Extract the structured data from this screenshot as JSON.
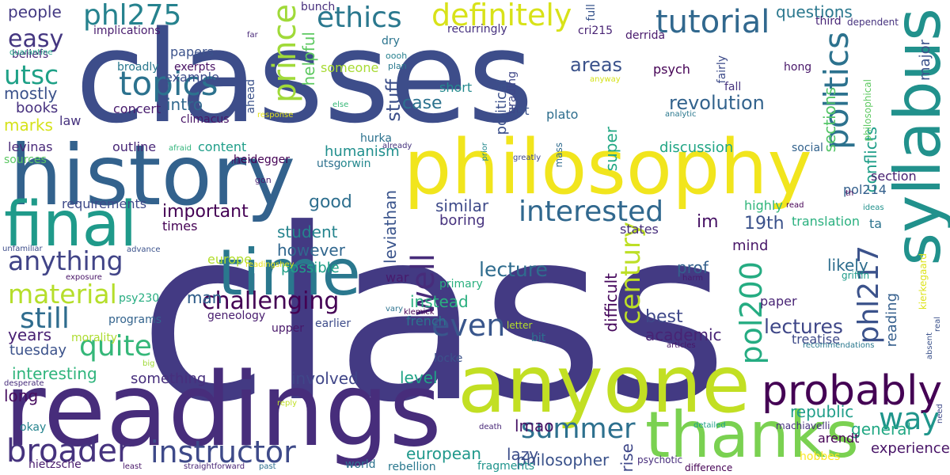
{
  "words": [
    {
      "text": "class",
      "color": "#433a83",
      "vertical": false
    },
    {
      "text": "classes",
      "color": "#3d4d8a",
      "vertical": false
    },
    {
      "text": "readings",
      "color": "#472d7b",
      "vertical": false
    },
    {
      "text": "history",
      "color": "#33628d",
      "vertical": false
    },
    {
      "text": "philosophy",
      "color": "#f1e51d",
      "vertical": false
    },
    {
      "text": "anyone",
      "color": "#c2df23",
      "vertical": false
    },
    {
      "text": "time",
      "color": "#2a788e",
      "vertical": false
    },
    {
      "text": "final",
      "color": "#1f9a8a",
      "vertical": false
    },
    {
      "text": "thanks",
      "color": "#7ad151",
      "vertical": false
    },
    {
      "text": "syllabus",
      "color": "#21918c",
      "vertical": true
    },
    {
      "text": "probably",
      "color": "#440154",
      "vertical": false
    },
    {
      "text": "broader",
      "color": "#46337e",
      "vertical": false
    },
    {
      "text": "instructor",
      "color": "#3e4a89",
      "vertical": false
    },
    {
      "text": "tutorial",
      "color": "#31688e",
      "vertical": false
    },
    {
      "text": "definitely",
      "color": "#d8e219",
      "vertical": false
    },
    {
      "text": "topics",
      "color": "#2c728e",
      "vertical": false
    },
    {
      "text": "phl275",
      "color": "#26828e",
      "vertical": false
    },
    {
      "text": "easy",
      "color": "#453781",
      "vertical": false
    },
    {
      "text": "utsc",
      "color": "#1fa187",
      "vertical": false
    },
    {
      "text": "ethics",
      "color": "#2a788e",
      "vertical": false
    },
    {
      "text": "anything",
      "color": "#414487",
      "vertical": false
    },
    {
      "text": "material",
      "color": "#b5de2b",
      "vertical": false
    },
    {
      "text": "still",
      "color": "#2f6c8e",
      "vertical": false
    },
    {
      "text": "quite",
      "color": "#35b779",
      "vertical": false
    },
    {
      "text": "interested",
      "color": "#31688e",
      "vertical": false
    },
    {
      "text": "challenging",
      "color": "#440154",
      "vertical": false
    },
    {
      "text": "even",
      "color": "#39568c",
      "vertical": false
    },
    {
      "text": "politics",
      "color": "#2c728e",
      "vertical": true
    },
    {
      "text": "prince",
      "color": "#a0da39",
      "vertical": true
    },
    {
      "text": "century",
      "color": "#bddf26",
      "vertical": true
    },
    {
      "text": "pol200",
      "color": "#25ac82",
      "vertical": true
    },
    {
      "text": "phl217",
      "color": "#3b528b",
      "vertical": true
    },
    {
      "text": "well",
      "color": "#472c7a",
      "vertical": true
    },
    {
      "text": "way",
      "color": "#1f958b",
      "vertical": false
    },
    {
      "text": "summer",
      "color": "#2d708e",
      "vertical": false
    },
    {
      "text": "revolution",
      "color": "#33638d",
      "vertical": false
    },
    {
      "text": "lecture",
      "color": "#2f6c8e",
      "vertical": false
    },
    {
      "text": "lectures",
      "color": "#3f4788",
      "vertical": false
    },
    {
      "text": "questions",
      "color": "#2a788e",
      "vertical": false
    },
    {
      "text": "people",
      "color": "#443a83",
      "vertical": false
    },
    {
      "text": "mostly",
      "color": "#3b528b",
      "vertical": false
    },
    {
      "text": "marks",
      "color": "#d5e21a",
      "vertical": false
    },
    {
      "text": "books",
      "color": "#46307e",
      "vertical": false
    },
    {
      "text": "intro",
      "color": "#31688e",
      "vertical": false
    },
    {
      "text": "case",
      "color": "#2c728e",
      "vertical": false
    },
    {
      "text": "stuff",
      "color": "#3c4f8a",
      "vertical": true
    },
    {
      "text": "helpful",
      "color": "#5ec962",
      "vertical": true
    },
    {
      "text": "areas",
      "color": "#3b528b",
      "vertical": false
    },
    {
      "text": "super",
      "color": "#22a884",
      "vertical": true
    },
    {
      "text": "political",
      "color": "#3c508b",
      "vertical": true
    },
    {
      "text": "humanism",
      "color": "#218f8d",
      "vertical": false
    },
    {
      "text": "sections",
      "color": "#54c568",
      "vertical": true
    },
    {
      "text": "conflicts",
      "color": "#1f9e89",
      "vertical": true
    },
    {
      "text": "important",
      "color": "#440154",
      "vertical": false
    },
    {
      "text": "good",
      "color": "#2e6f8e",
      "vertical": false
    },
    {
      "text": "similar",
      "color": "#3e4a89",
      "vertical": false
    },
    {
      "text": "im",
      "color": "#471365",
      "vertical": false
    },
    {
      "text": "19th",
      "color": "#3b528b",
      "vertical": false
    },
    {
      "text": "student",
      "color": "#25848e",
      "vertical": false
    },
    {
      "text": "however",
      "color": "#31678e",
      "vertical": false
    },
    {
      "text": "possible",
      "color": "#1fa088",
      "vertical": false
    },
    {
      "text": "instead",
      "color": "#29af7f",
      "vertical": false
    },
    {
      "text": "leviathan",
      "color": "#3a548c",
      "vertical": true
    },
    {
      "text": "boring",
      "color": "#46327e",
      "vertical": false
    },
    {
      "text": "prof",
      "color": "#34608d",
      "vertical": false
    },
    {
      "text": "likely",
      "color": "#2e6e8e",
      "vertical": false
    },
    {
      "text": "mind",
      "color": "#481769",
      "vertical": false
    },
    {
      "text": "best",
      "color": "#3f4889",
      "vertical": false
    },
    {
      "text": "academic",
      "color": "#482374",
      "vertical": false
    },
    {
      "text": "reading",
      "color": "#355f8d",
      "vertical": true
    },
    {
      "text": "difficult",
      "color": "#46085c",
      "vertical": true
    },
    {
      "text": "interesting",
      "color": "#2fb47c",
      "vertical": false
    },
    {
      "text": "involved",
      "color": "#404688",
      "vertical": false
    },
    {
      "text": "years",
      "color": "#482173",
      "vertical": false
    },
    {
      "text": "tuesday",
      "color": "#3b528b",
      "vertical": false
    },
    {
      "text": "long",
      "color": "#470d60",
      "vertical": false
    },
    {
      "text": "something",
      "color": "#472f7d",
      "vertical": false
    },
    {
      "text": "level",
      "color": "#20a386",
      "vertical": false
    },
    {
      "text": "lmao",
      "color": "#471365",
      "vertical": false
    },
    {
      "text": "republic",
      "color": "#1f9e89",
      "vertical": false
    },
    {
      "text": "general",
      "color": "#22a884",
      "vertical": false
    },
    {
      "text": "experience",
      "color": "#481467",
      "vertical": false
    },
    {
      "text": "european",
      "color": "#1f988b",
      "vertical": false
    },
    {
      "text": "lazy",
      "color": "#3d4e8a",
      "vertical": false
    },
    {
      "text": "rise",
      "color": "#3f4889",
      "vertical": true
    },
    {
      "text": "philosopher",
      "color": "#3b528b",
      "vertical": false
    },
    {
      "text": "man",
      "color": "#34618d",
      "vertical": false
    },
    {
      "text": "paper",
      "color": "#482475",
      "vertical": false
    },
    {
      "text": "man",
      "color": "#34618d",
      "vertical": false
    },
    {
      "text": "content",
      "color": "#1f9e89",
      "vertical": false
    },
    {
      "text": "outline",
      "color": "#482677",
      "vertical": false
    },
    {
      "text": "discussion",
      "color": "#21a685",
      "vertical": false
    },
    {
      "text": "example",
      "color": "#3d4d8a",
      "vertical": false
    },
    {
      "text": "concert",
      "color": "#481c6e",
      "vertical": false
    },
    {
      "text": "law",
      "color": "#46327e",
      "vertical": false
    },
    {
      "text": "levinas",
      "color": "#482878",
      "vertical": false
    },
    {
      "text": "requirements",
      "color": "#3e4989",
      "vertical": false
    },
    {
      "text": "times",
      "color": "#440154",
      "vertical": false
    },
    {
      "text": "europe",
      "color": "#b2dd2d",
      "vertical": false
    },
    {
      "text": "war",
      "color": "#481a6c",
      "vertical": false
    },
    {
      "text": "french",
      "color": "#2c738e",
      "vertical": false
    },
    {
      "text": "states",
      "color": "#472e7c",
      "vertical": false
    },
    {
      "text": "highly",
      "color": "#31b57b",
      "vertical": false
    },
    {
      "text": "section",
      "color": "#482071",
      "vertical": false
    },
    {
      "text": "pol214",
      "color": "#34608d",
      "vertical": false
    },
    {
      "text": "translation",
      "color": "#2ab07f",
      "vertical": false
    },
    {
      "text": "ta",
      "color": "#2c738e",
      "vertical": false
    },
    {
      "text": "treatise",
      "color": "#3e4a89",
      "vertical": false
    },
    {
      "text": "papers",
      "color": "#3b528b",
      "vertical": false
    },
    {
      "text": "beliefs",
      "color": "#482878",
      "vertical": false
    },
    {
      "text": "implications",
      "color": "#481b6d",
      "vertical": false
    },
    {
      "text": "broadly",
      "color": "#2a788e",
      "vertical": false
    },
    {
      "text": "exerpts",
      "color": "#471063",
      "vertical": false
    },
    {
      "text": "climacus",
      "color": "#481467",
      "vertical": false
    },
    {
      "text": "sources",
      "color": "#5cc863",
      "vertical": false
    },
    {
      "text": "someone",
      "color": "#a8db34",
      "vertical": false
    },
    {
      "text": "heidegger",
      "color": "#440154",
      "vertical": false
    },
    {
      "text": "list",
      "color": "#3b528b",
      "vertical": false
    },
    {
      "text": "plato",
      "color": "#2e6e8e",
      "vertical": false
    },
    {
      "text": "grading",
      "color": "#3f4788",
      "vertical": true
    },
    {
      "text": "short",
      "color": "#23898e",
      "vertical": false
    },
    {
      "text": "psych",
      "color": "#440154",
      "vertical": false
    },
    {
      "text": "hong",
      "color": "#481769",
      "vertical": false
    },
    {
      "text": "fall",
      "color": "#46337e",
      "vertical": false
    },
    {
      "text": "derrida",
      "color": "#481a6c",
      "vertical": false
    },
    {
      "text": "cri215",
      "color": "#482374",
      "vertical": false
    },
    {
      "text": "recurringly",
      "color": "#46317e",
      "vertical": false
    },
    {
      "text": "bunch",
      "color": "#472f7d",
      "vertical": false
    },
    {
      "text": "third",
      "color": "#482677",
      "vertical": false
    },
    {
      "text": "major",
      "color": "#3b528b",
      "vertical": true
    },
    {
      "text": "full",
      "color": "#39568c",
      "vertical": true
    },
    {
      "text": "dependent",
      "color": "#46327e",
      "vertical": false
    },
    {
      "text": "dry",
      "color": "#2b748e",
      "vertical": false
    },
    {
      "text": "oooh",
      "color": "#27808e",
      "vertical": false
    },
    {
      "text": "plan",
      "color": "#2a788e",
      "vertical": false
    },
    {
      "text": "ahead",
      "color": "#3b528b",
      "vertical": true
    },
    {
      "text": "fairly",
      "color": "#3e4c8a",
      "vertical": true
    },
    {
      "text": "philosophical",
      "color": "#5ec962",
      "vertical": true
    },
    {
      "text": "hurka",
      "color": "#2c728e",
      "vertical": false
    },
    {
      "text": "utsg",
      "color": "#2d718e",
      "vertical": false
    },
    {
      "text": "orwin",
      "color": "#23888e",
      "vertical": false
    },
    {
      "text": "social",
      "color": "#33638d",
      "vertical": false
    },
    {
      "text": "gon",
      "color": "#482071",
      "vertical": false
    },
    {
      "text": "quarantine",
      "color": "#20a386",
      "vertical": false
    },
    {
      "text": "far",
      "color": "#482878",
      "vertical": false
    },
    {
      "text": "response",
      "color": "#e5e419",
      "vertical": false
    },
    {
      "text": "else",
      "color": "#37b878",
      "vertical": false
    },
    {
      "text": "anyway",
      "color": "#d5e21a",
      "vertical": false
    },
    {
      "text": "analytic",
      "color": "#2a788e",
      "vertical": false
    },
    {
      "text": "afraid",
      "color": "#31b57b",
      "vertical": false
    },
    {
      "text": "already",
      "color": "#46337e",
      "vertical": false
    },
    {
      "text": "greatly",
      "color": "#3f4889",
      "vertical": false
    },
    {
      "text": "prior",
      "color": "#23898e",
      "vertical": true
    },
    {
      "text": "mass",
      "color": "#2f6b8e",
      "vertical": true
    },
    {
      "text": "th",
      "color": "#440154",
      "vertical": false
    },
    {
      "text": "na",
      "color": "#481c6e",
      "vertical": false
    },
    {
      "text": "read",
      "color": "#440154",
      "vertical": false
    },
    {
      "text": "ideas",
      "color": "#21918c",
      "vertical": false
    },
    {
      "text": "kierkegaard",
      "color": "#dde318",
      "vertical": true
    },
    {
      "text": "griffin",
      "color": "#1e9b8a",
      "vertical": false
    },
    {
      "text": "harm",
      "color": "#481b6d",
      "vertical": false
    },
    {
      "text": "real",
      "color": "#3b528b",
      "vertical": true
    },
    {
      "text": "unfamiliar",
      "color": "#3d4d8a",
      "vertical": false
    },
    {
      "text": "advance",
      "color": "#3b528b",
      "vertical": false
    },
    {
      "text": "readingshey",
      "color": "#e7e419",
      "vertical": false
    },
    {
      "text": "exposure",
      "color": "#481467",
      "vertical": false
    },
    {
      "text": "primary",
      "color": "#2ab07f",
      "vertical": false
    },
    {
      "text": "psy230",
      "color": "#27ad81",
      "vertical": false
    },
    {
      "text": "programs",
      "color": "#33638d",
      "vertical": false
    },
    {
      "text": "morality",
      "color": "#addc30",
      "vertical": false
    },
    {
      "text": "geneology",
      "color": "#481c6e",
      "vertical": false
    },
    {
      "text": "upper",
      "color": "#481769",
      "vertical": false
    },
    {
      "text": "earlier",
      "color": "#3e4c8a",
      "vertical": false
    },
    {
      "text": "vary",
      "color": "#2c728e",
      "vertical": false
    },
    {
      "text": "klemick",
      "color": "#440154",
      "vertical": false
    },
    {
      "text": "letter",
      "color": "#b5de2b",
      "vertical": false
    },
    {
      "text": "bit",
      "color": "#2d708e",
      "vertical": false
    },
    {
      "text": "locke",
      "color": "#3b528b",
      "vertical": false
    },
    {
      "text": "articles",
      "color": "#481769",
      "vertical": false
    },
    {
      "text": "absent",
      "color": "#3b528b",
      "vertical": true
    },
    {
      "text": "recommendations",
      "color": "#2a788e",
      "vertical": false
    },
    {
      "text": "big",
      "color": "#a0da39",
      "vertical": false
    },
    {
      "text": "desperate",
      "color": "#472d7b",
      "vertical": false
    },
    {
      "text": "reply",
      "color": "#c0df25",
      "vertical": false
    },
    {
      "text": "okay",
      "color": "#25848e",
      "vertical": false
    },
    {
      "text": "need",
      "color": "#3e4989",
      "vertical": true
    },
    {
      "text": "machiavelli",
      "color": "#46327e",
      "vertical": false
    },
    {
      "text": "detailed",
      "color": "#1fa187",
      "vertical": false
    },
    {
      "text": "death",
      "color": "#482878",
      "vertical": false
    },
    {
      "text": "arendt",
      "color": "#440154",
      "vertical": false
    },
    {
      "text": "hobbes",
      "color": "#fde725",
      "vertical": false
    },
    {
      "text": "psychotic",
      "color": "#472d7b",
      "vertical": false
    },
    {
      "text": "difference",
      "color": "#440154",
      "vertical": false
    },
    {
      "text": "fragments",
      "color": "#1f948c",
      "vertical": false
    },
    {
      "text": "rebellion",
      "color": "#2a788e",
      "vertical": false
    },
    {
      "text": "world",
      "color": "#2c738e",
      "vertical": false
    },
    {
      "text": "nietzsche",
      "color": "#481b6d",
      "vertical": false
    },
    {
      "text": "least",
      "color": "#481769",
      "vertical": false
    },
    {
      "text": "straightforward",
      "color": "#482475",
      "vertical": false
    },
    {
      "text": "past",
      "color": "#2e6e8e",
      "vertical": false
    }
  ]
}
